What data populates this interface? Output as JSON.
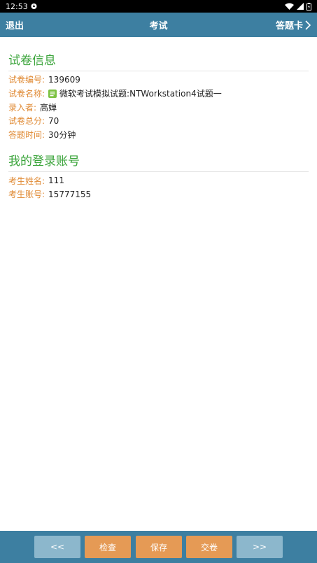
{
  "status_bar": {
    "time": "12:53"
  },
  "app_bar": {
    "exit_label": "退出",
    "title": "考试",
    "card_label": "答题卡"
  },
  "paper_info": {
    "heading": "试卷信息",
    "rows": [
      {
        "label": "试卷编号:",
        "value": "139609"
      },
      {
        "label": "试卷名称:",
        "value": "微软考试模拟试题:NTWorkstation4试题一"
      },
      {
        "label": "录入者:",
        "value": "高婵"
      },
      {
        "label": "试卷总分:",
        "value": "70"
      },
      {
        "label": "答题时间:",
        "value": "30分钟"
      }
    ]
  },
  "account_info": {
    "heading": "我的登录账号",
    "rows": [
      {
        "label": "考生姓名:",
        "value": "111"
      },
      {
        "label": "考生账号:",
        "value": "15777155"
      }
    ]
  },
  "bottom_bar": {
    "prev_label": "<<",
    "check_label": "检查",
    "save_label": "保存",
    "submit_label": "交卷",
    "next_label": ">>"
  },
  "colors": {
    "primary": "#3d7fa1",
    "heading_green": "#3aa43a",
    "label_orange": "#e08a34",
    "action_button": "#e59a55",
    "nav_button": "#8cb7cc"
  }
}
